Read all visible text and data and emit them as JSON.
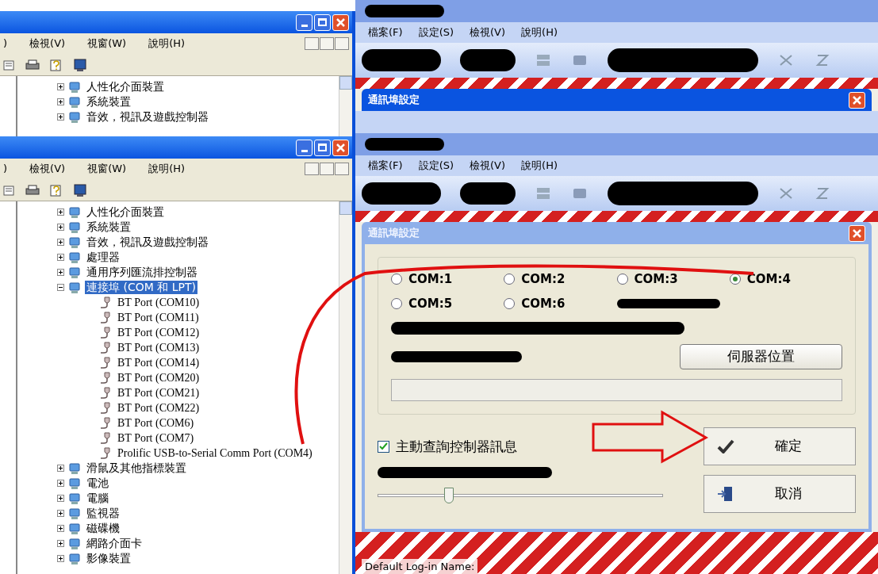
{
  "device_manager_windows": [
    {
      "menu": [
        ")",
        "檢視(V)",
        "視窗(W)",
        "說明(H)"
      ],
      "tree": [
        {
          "label": "人性化介面裝置",
          "expanded": false,
          "selected": false
        },
        {
          "label": "系統裝置",
          "expanded": false,
          "selected": false
        },
        {
          "label": "音效，視訊及遊戲控制器",
          "expanded": false,
          "selected": false
        }
      ]
    },
    {
      "menu": [
        ")",
        "檢視(V)",
        "視窗(W)",
        "說明(H)"
      ],
      "tree": [
        {
          "label": "人性化介面裝置",
          "expanded": false,
          "selected": false
        },
        {
          "label": "系統裝置",
          "expanded": false,
          "selected": false
        },
        {
          "label": "音效，視訊及遊戲控制器",
          "expanded": false,
          "selected": false
        },
        {
          "label": "處理器",
          "expanded": false,
          "selected": false
        },
        {
          "label": "通用序列匯流排控制器",
          "expanded": false,
          "selected": false
        },
        {
          "label": "連接埠 (COM 和 LPT)",
          "expanded": true,
          "selected": true,
          "children": [
            {
              "label": "BT Port (COM10)",
              "selected": false
            },
            {
              "label": "BT Port (COM11)",
              "selected": false
            },
            {
              "label": "BT Port (COM12)",
              "selected": false
            },
            {
              "label": "BT Port (COM13)",
              "selected": false
            },
            {
              "label": "BT Port (COM14)",
              "selected": false
            },
            {
              "label": "BT Port (COM20)",
              "selected": false
            },
            {
              "label": "BT Port (COM21)",
              "selected": false
            },
            {
              "label": "BT Port (COM22)",
              "selected": false
            },
            {
              "label": "BT Port (COM6)",
              "selected": false
            },
            {
              "label": "BT Port (COM7)",
              "selected": false
            },
            {
              "label": "Prolific USB-to-Serial Comm Port (COM4)",
              "selected": false
            }
          ]
        },
        {
          "label": "滑鼠及其他指標裝置",
          "expanded": false,
          "selected": false
        },
        {
          "label": "電池",
          "expanded": false,
          "selected": false
        },
        {
          "label": "電腦",
          "expanded": false,
          "selected": false
        },
        {
          "label": "監視器",
          "expanded": false,
          "selected": false
        },
        {
          "label": "磁碟機",
          "expanded": false,
          "selected": false
        },
        {
          "label": "網路介面卡",
          "expanded": false,
          "selected": false
        },
        {
          "label": "影像裝置",
          "expanded": false,
          "selected": false
        }
      ]
    }
  ],
  "app_windows": [
    {
      "menu": [
        "檔案(F)",
        "設定(S)",
        "檢視(V)",
        "說明(H)"
      ],
      "dialog_title": "通訊埠設定"
    },
    {
      "menu": [
        "檔案(F)",
        "設定(S)",
        "檢視(V)",
        "說明(H)"
      ],
      "dialog_title": "通訊埠設定",
      "dialog": {
        "ports": [
          {
            "label": "COM:1",
            "selected": false
          },
          {
            "label": "COM:2",
            "selected": false
          },
          {
            "label": "COM:3",
            "selected": false
          },
          {
            "label": "COM:4",
            "selected": true
          },
          {
            "label": "COM:5",
            "selected": false
          },
          {
            "label": "COM:6",
            "selected": false
          }
        ],
        "server_button": "伺服器位置",
        "poll_checkbox": {
          "label": "主動查詢控制器訊息",
          "checked": true
        },
        "slider": {
          "level": 0.25
        },
        "ok_button": "確定",
        "cancel_button": "取消"
      },
      "status": "Default Log-in Name:"
    }
  ]
}
